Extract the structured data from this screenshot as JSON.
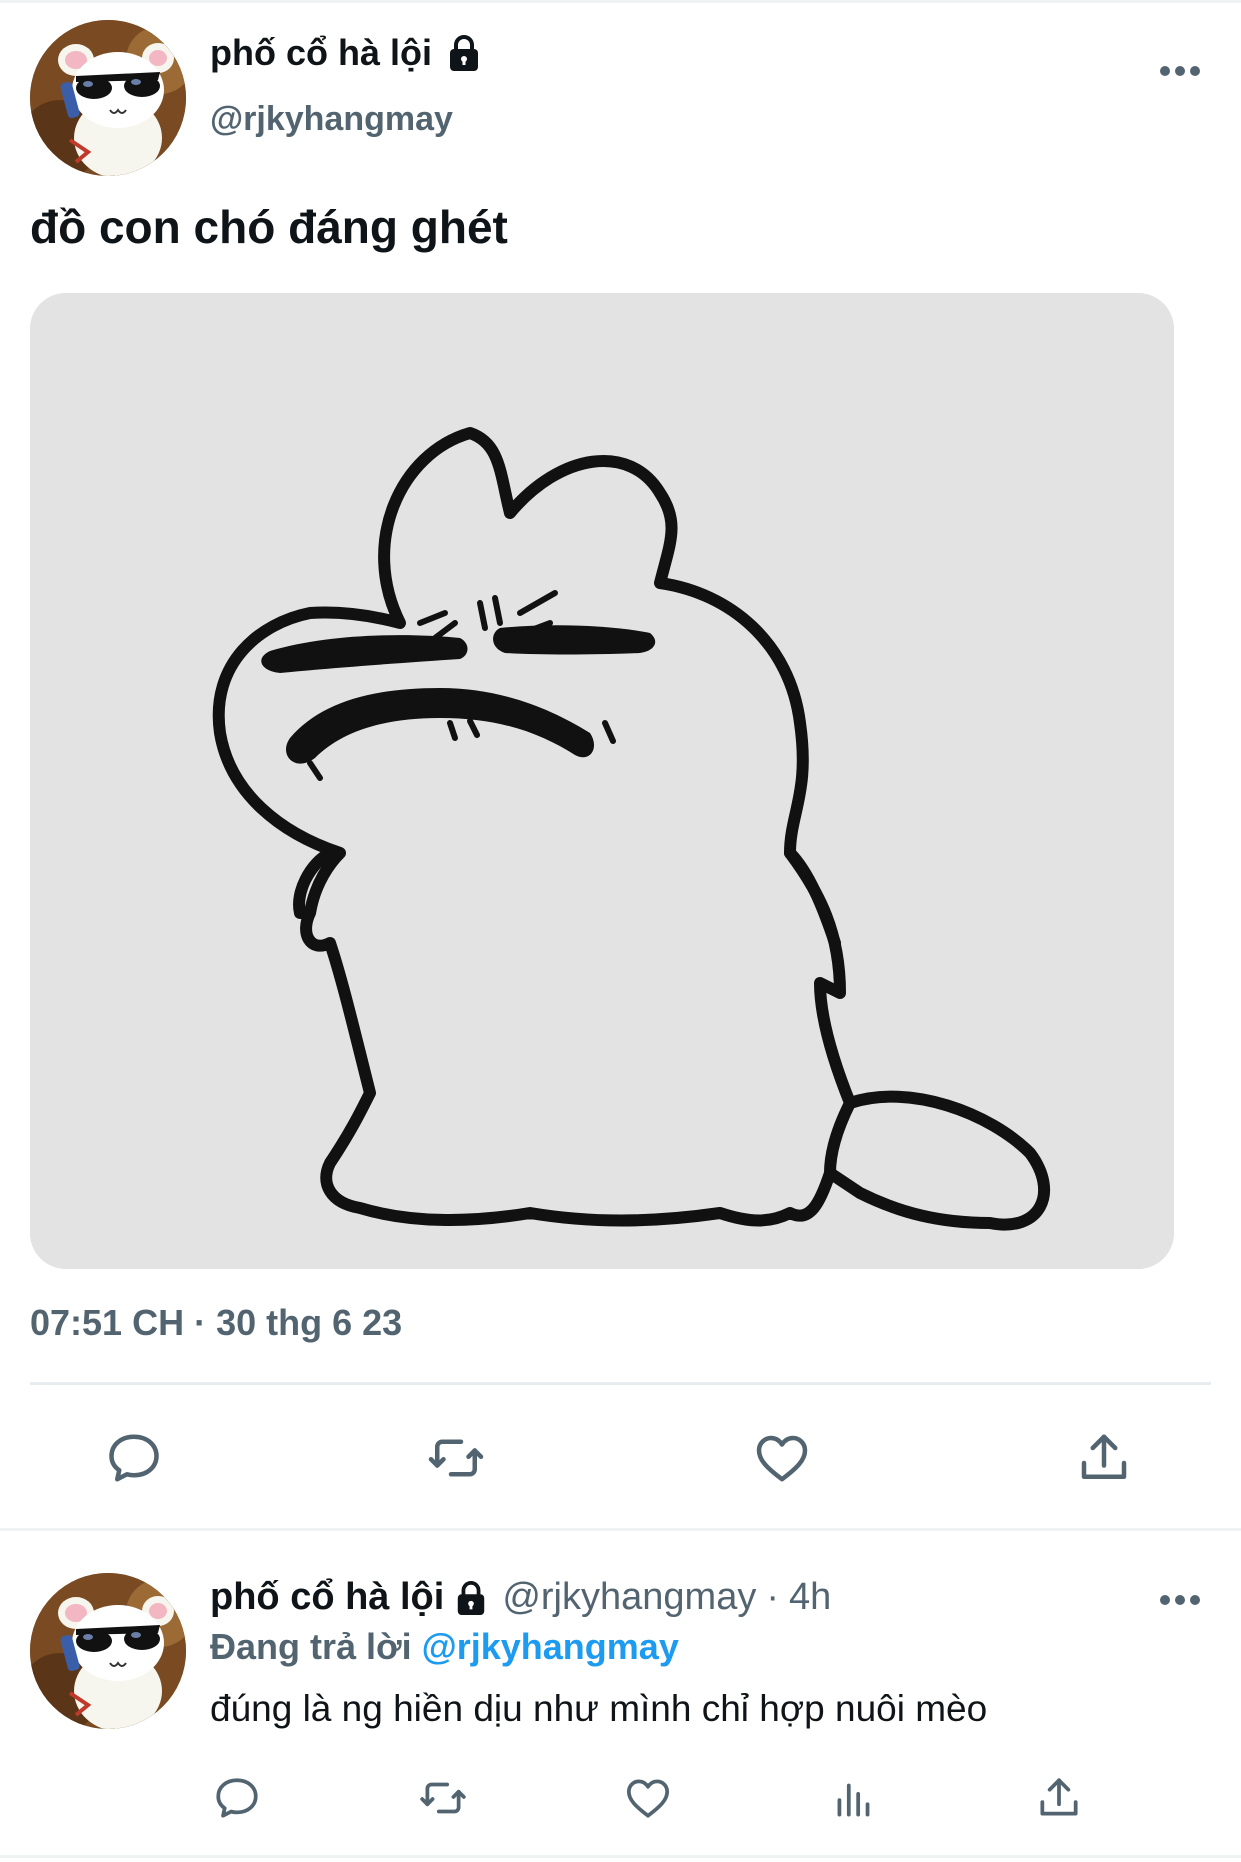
{
  "main_tweet": {
    "author_name": "phố cổ hà lội",
    "author_handle": "@rjkyhangmay",
    "text": "đồ con chó đáng ghét",
    "timestamp": "07:51 CH · 30 thg 6 23",
    "icons": {
      "lock": "lock-icon",
      "more": "more-icon",
      "reply": "reply-icon",
      "retweet": "retweet-icon",
      "like": "like-icon",
      "share": "share-icon"
    }
  },
  "reply_tweet": {
    "author_name": "phố cổ hà lội",
    "author_handle": "@rjkyhangmay",
    "separator": "·",
    "time_ago": "4h",
    "replying_label": "Đang trả lời",
    "replying_to": "@rjkyhangmay",
    "text": "đúng là ng hiền dịu như mình chỉ hợp nuôi mèo",
    "icons": {
      "reply": "reply-icon",
      "retweet": "retweet-icon",
      "like": "like-icon",
      "views": "views-icon",
      "share": "share-icon"
    }
  },
  "colors": {
    "text_primary": "#0f1419",
    "text_secondary": "#536471",
    "link": "#1d9bf0",
    "divider": "#e6ecf0",
    "media_background": "#e3e3e3"
  }
}
